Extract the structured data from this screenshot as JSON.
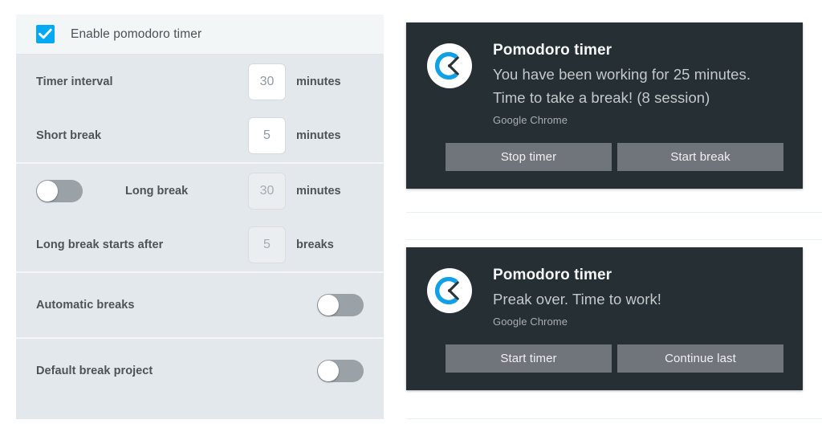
{
  "settings": {
    "enable": {
      "label": "Enable pomodoro timer",
      "checked": true,
      "accent_color": "#03a9f4"
    },
    "rows": [
      {
        "label": "Timer interval",
        "value": "30",
        "unit": "minutes"
      },
      {
        "label": "Short break",
        "value": "5",
        "unit": "minutes"
      },
      {
        "label": "Long break",
        "value": "30",
        "unit": "minutes",
        "toggle": "off"
      },
      {
        "label": "Long break starts after",
        "value": "5",
        "unit": "breaks"
      },
      {
        "label": "Automatic breaks",
        "toggle": "off"
      },
      {
        "label": "Default break project",
        "toggle": "off"
      }
    ]
  },
  "notifications": [
    {
      "icon": "clockify-logo-icon",
      "title": "Pomodoro timer",
      "message_line1": "You have been working for 25 minutes.",
      "message_line2": "Time to take a break! (8 session)",
      "source": "Google Chrome",
      "buttons": [
        "Stop timer",
        "Start break"
      ]
    },
    {
      "icon": "clockify-logo-icon",
      "title": "Pomodoro timer",
      "message_line1": "Preak over. Time to work!",
      "message_line2": "",
      "source": "Google Chrome",
      "buttons": [
        "Start timer",
        "Continue last"
      ]
    }
  ],
  "colors": {
    "accent": "#03a9f4",
    "notification_bg": "#262f33",
    "notification_button_bg": "#70757c",
    "panel_bg": "#e3e8ec",
    "panel_header_bg": "#f3f6f7",
    "toggle_off": "#9aa1a7"
  }
}
